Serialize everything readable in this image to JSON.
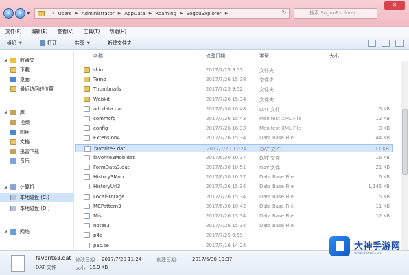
{
  "address": {
    "crumbs": [
      "Users",
      "Administrator",
      "AppData",
      "Roaming",
      "SogouExplorer"
    ],
    "search_placeholder": "搜索 SogouExplorer"
  },
  "menu": [
    "文件(F)",
    "编辑(E)",
    "查看(V)",
    "工具(T)",
    "帮助(H)"
  ],
  "toolbar": {
    "organize": "组织",
    "open": "打开",
    "share": "共享",
    "new_folder": "新建文件夹"
  },
  "nav": {
    "favorites": "收藏夹",
    "downloads": "下载",
    "desktop": "桌面",
    "recent": "最近访问的位置",
    "libraries": "库",
    "videos": "视频",
    "pictures": "图片",
    "documents": "文档",
    "thunder": "迅雷下载",
    "music": "音乐",
    "computer": "计算机",
    "local_c": "本地磁盘 (C:)",
    "local_d": "本地磁盘 (D:)",
    "network": "网络"
  },
  "columns": {
    "name": "名称",
    "date": "修改日期",
    "type": "类型",
    "size": "大小"
  },
  "files": [
    {
      "name": "skin",
      "date": "2017/7/25 9:53",
      "type": "文件夹",
      "size": "",
      "kind": "folder"
    },
    {
      "name": "Temp",
      "date": "2017/7/26 15:38",
      "type": "文件夹",
      "size": "",
      "kind": "folder"
    },
    {
      "name": "Thumbnails",
      "date": "2017/7/25 9:52",
      "type": "文件夹",
      "size": "",
      "kind": "folder"
    },
    {
      "name": "Webkit",
      "date": "2017/7/26 15:34",
      "type": "文件夹",
      "size": "",
      "kind": "folder"
    },
    {
      "name": "adbdata.dat",
      "date": "2017/6/30 10:48",
      "type": "DAT 文件",
      "size": "5 KB",
      "kind": "file"
    },
    {
      "name": "commcfg",
      "date": "2017/7/26 15:43",
      "type": "Manifest XML File",
      "size": "12 KB",
      "kind": "file"
    },
    {
      "name": "config",
      "date": "2017/7/26 16:33",
      "type": "Manifest XML File",
      "size": "3 KB",
      "kind": "file"
    },
    {
      "name": "Extension4",
      "date": "2017/7/26 15:34",
      "type": "Data Base File",
      "size": "44 KB",
      "kind": "file"
    },
    {
      "name": "favorite3.dat",
      "date": "2017/7/20 11:24",
      "type": "DAT 文件",
      "size": "17 KB",
      "kind": "file",
      "selected": true
    },
    {
      "name": "favorite3Mob.dat",
      "date": "2017/6/30 10:37",
      "type": "DAT 文件",
      "size": "16 KB",
      "kind": "file"
    },
    {
      "name": "FormData3.dat",
      "date": "2017/6/30 10:51",
      "type": "DAT 文件",
      "size": "21 KB",
      "kind": "file"
    },
    {
      "name": "History3Mob",
      "date": "2017/6/30 10:37",
      "type": "Data Base File",
      "size": "6 KB",
      "kind": "file"
    },
    {
      "name": "HistoryUrl3",
      "date": "2017/7/26 15:34",
      "type": "Data Base File",
      "size": "1,145 KB",
      "kind": "file"
    },
    {
      "name": "LocalStorage",
      "date": "2017/7/26 15:34",
      "type": "Data Base File",
      "size": "5 KB",
      "kind": "file"
    },
    {
      "name": "MCPattern3",
      "date": "2017/6/30 10:42",
      "type": "Data Base File",
      "size": "11 KB",
      "kind": "file"
    },
    {
      "name": "Misc",
      "date": "2017/7/26 15:34",
      "type": "Data Base File",
      "size": "12 KB",
      "kind": "file"
    },
    {
      "name": "notes3",
      "date": "2017/7/26 15:34",
      "type": "Data Base File",
      "size": "",
      "kind": "file"
    },
    {
      "name": "p4p",
      "date": "2017/7/25 9:59",
      "type": "",
      "size": "",
      "kind": "file"
    },
    {
      "name": "pac.se",
      "date": "2017/7/16 14:24",
      "type": "",
      "size": "",
      "kind": "file"
    }
  ],
  "details": {
    "name": "favorite3.dat",
    "modified_label": "修改日期:",
    "modified_value": "2017/7/20 11:24",
    "created_label": "创建日期:",
    "created_value": "2017/6/30 10:37",
    "type": "DAT 文件",
    "size_label": "大小:",
    "size_value": "16.9 KB"
  },
  "watermark": {
    "text": "大神手游网",
    "sub": "www.dssyw.com"
  },
  "colors": {
    "title_bar": "#f1b9c2",
    "selection": "#d4e6fb",
    "logo_blue": "#1457c4"
  }
}
